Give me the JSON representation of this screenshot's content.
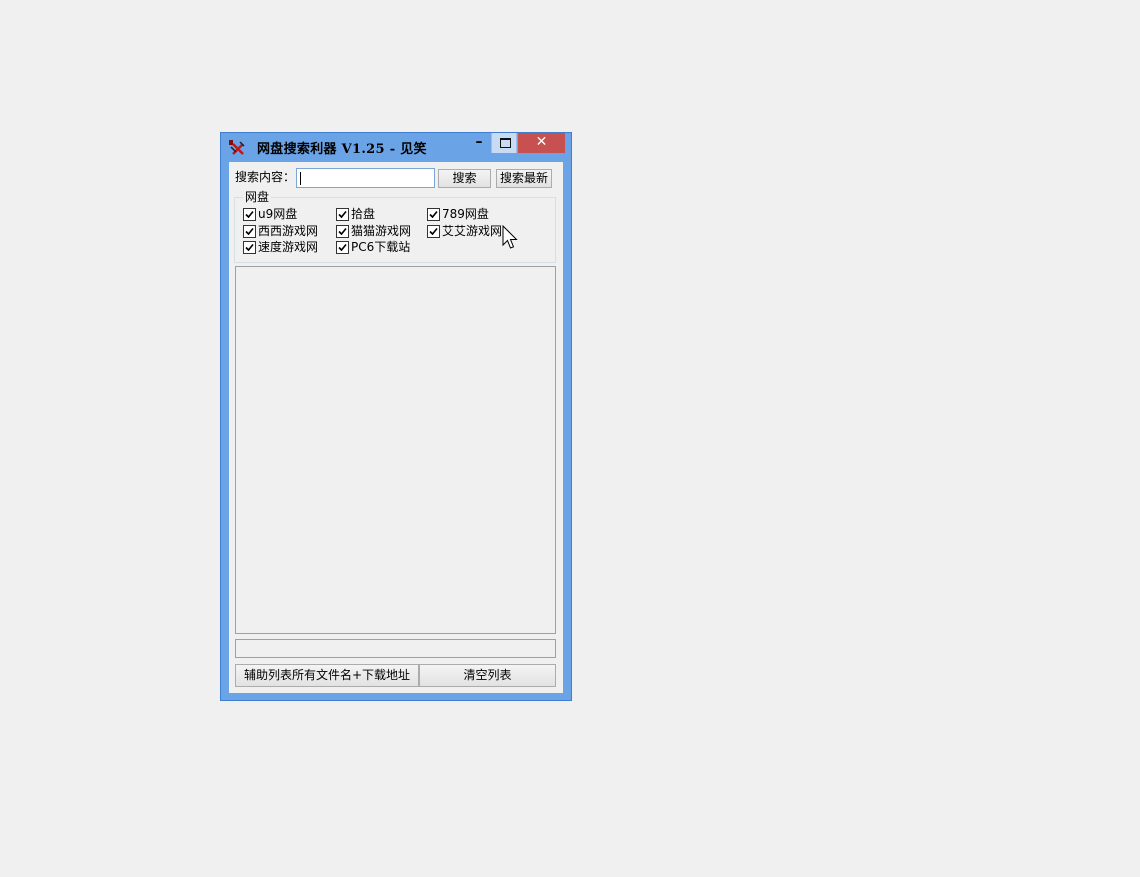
{
  "window": {
    "title": "网盘搜索利器 V1.25 - 见笑",
    "minimize_glyph": "–",
    "close_glyph": "✕"
  },
  "search": {
    "label": "搜索内容：",
    "value": "",
    "search_button": "搜索",
    "latest_button": "搜索最新"
  },
  "group": {
    "title": "网盘",
    "options": [
      {
        "label": "u9网盘",
        "checked": true
      },
      {
        "label": "拾盘",
        "checked": true
      },
      {
        "label": "789网盘",
        "checked": true
      },
      {
        "label": "西西游戏网",
        "checked": true
      },
      {
        "label": "猫猫游戏网",
        "checked": true
      },
      {
        "label": "艾艾游戏网",
        "checked": true
      },
      {
        "label": "速度游戏网",
        "checked": true
      },
      {
        "label": "PC6下载站",
        "checked": true
      }
    ]
  },
  "buttons": {
    "extract": "辅助列表所有文件名+下载地址",
    "clear": "清空列表"
  },
  "icons": {
    "app": "app-logo-icon",
    "minimize": "minimize-icon",
    "maximize": "maximize-icon",
    "close": "close-icon",
    "checkbox": "checkmark-icon",
    "cursor": "mouse-pointer-icon"
  },
  "colors": {
    "window_frame": "#6aa3e6",
    "close_button": "#c75050",
    "client_bg": "#f0f0f0"
  }
}
